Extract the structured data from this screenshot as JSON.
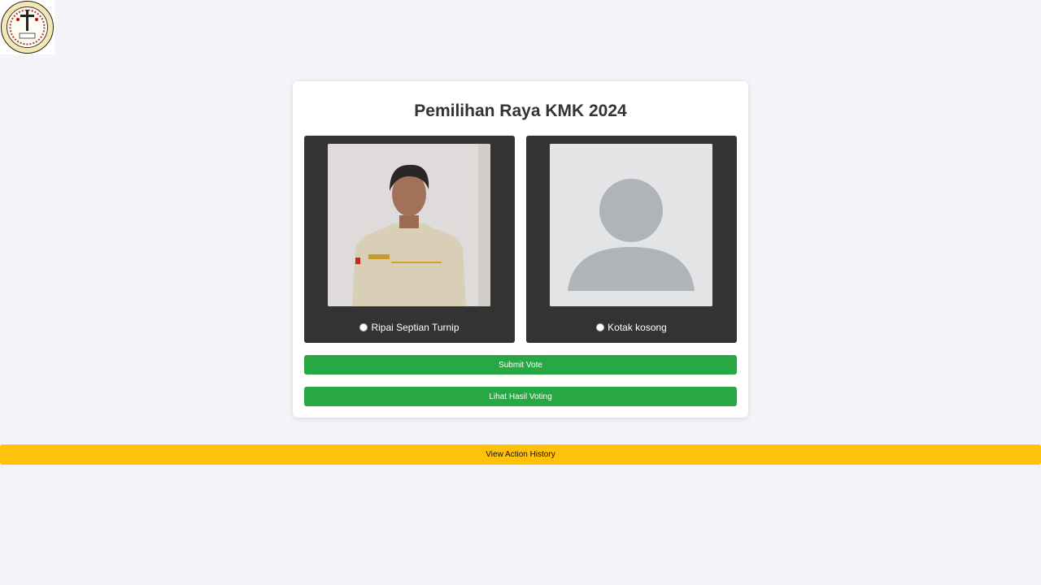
{
  "logo": {
    "icon": "kmk-emblem-logo"
  },
  "card": {
    "title": "Pemilihan Raya KMK 2024",
    "candidates": [
      {
        "name": "Ripai Septian Turnip",
        "photo_icon": "candidate-photo",
        "selected": false
      },
      {
        "name": "Kotak kosong",
        "photo_icon": "placeholder-avatar-icon",
        "selected": false
      }
    ],
    "submit_label": "Submit Vote",
    "results_label": "Lihat Hasil Voting"
  },
  "history_label": "View Action History",
  "colors": {
    "page_bg": "#f3f3f8",
    "card_bg": "#ffffff",
    "candidate_bg": "#333333",
    "button_green": "#28a745",
    "button_yellow": "#ffc10a"
  }
}
